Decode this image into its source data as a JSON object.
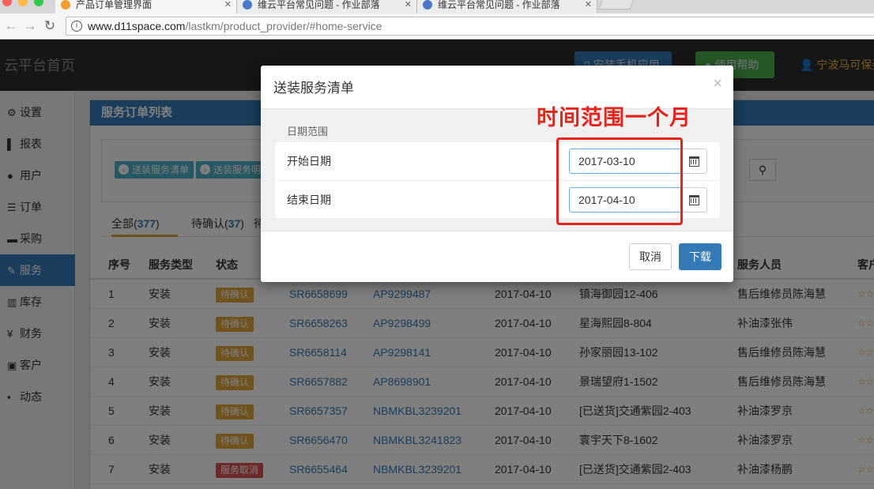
{
  "browser": {
    "tabs": [
      {
        "title": "产品订单管理界面",
        "active": true
      },
      {
        "title": "维云平台常见问题 - 作业部落",
        "active": false
      },
      {
        "title": "维云平台常见问题 - 作业部落",
        "active": false
      }
    ],
    "url_host": "www.d11space.com",
    "url_path": "/lastkm/product_provider/#home-service"
  },
  "topnav": {
    "brand": "云平台首页",
    "install_app": "安装手机应用",
    "help": "使用帮助",
    "user": "宁波马可保姿"
  },
  "sidebar": {
    "items": [
      {
        "label": "设置",
        "icon": "gear-icon"
      },
      {
        "label": "报表",
        "icon": "bar-chart-icon"
      },
      {
        "label": "用户",
        "icon": "user-icon"
      },
      {
        "label": "订单",
        "icon": "list-icon"
      },
      {
        "label": "采购",
        "icon": "cart-icon"
      },
      {
        "label": "服务",
        "icon": "wrench-icon",
        "active": true
      },
      {
        "label": "库存",
        "icon": "barcode-icon"
      },
      {
        "label": "财务",
        "icon": "yen-icon"
      },
      {
        "label": "客户",
        "icon": "briefcase-icon"
      },
      {
        "label": "动态",
        "icon": "comment-icon"
      }
    ]
  },
  "panel": {
    "title": "服务订单列表",
    "export_service_list": "送装服务清单",
    "export_service_detail": "送装服务明"
  },
  "status_tabs": [
    {
      "label": "全部(",
      "count": "377",
      "suffix": ")"
    },
    {
      "label": "待确认(",
      "count": "37",
      "suffix": ")"
    },
    {
      "label": "待",
      "count": "",
      "suffix": ""
    }
  ],
  "table": {
    "headers": [
      "序号",
      "服务类型",
      "状态",
      "服务人员",
      "客户"
    ],
    "rows": [
      {
        "no": "1",
        "type": "安装",
        "status": "待确认",
        "status_color": "orange",
        "sr": "SR6658699",
        "ap": "AP9299487",
        "date": "2017-04-10",
        "address": "镇海御园12-406",
        "staff": "售后维修员陈海慧",
        "stars": "☆☆"
      },
      {
        "no": "2",
        "type": "安装",
        "status": "待确认",
        "status_color": "orange",
        "sr": "SR6658263",
        "ap": "AP9298499",
        "date": "2017-04-10",
        "address": "星海熙园8-804",
        "staff": "补油漆张伟",
        "stars": "☆☆"
      },
      {
        "no": "3",
        "type": "安装",
        "status": "待确认",
        "status_color": "orange",
        "sr": "SR6658114",
        "ap": "AP9298141",
        "date": "2017-04-10",
        "address": "孙家丽园13-102",
        "staff": "售后维修员陈海慧",
        "stars": "☆☆"
      },
      {
        "no": "4",
        "type": "安装",
        "status": "待确认",
        "status_color": "orange",
        "sr": "SR6657882",
        "ap": "AP8698901",
        "date": "2017-04-10",
        "address": "景瑞望府1-1502",
        "staff": "售后维修员陈海慧",
        "stars": "☆☆"
      },
      {
        "no": "5",
        "type": "安装",
        "status": "待确认",
        "status_color": "orange",
        "sr": "SR6657357",
        "ap": "NBMKBL3239201",
        "date": "2017-04-10",
        "address": "[已送货]交通紫园2-403",
        "staff": "补油漆罗京",
        "stars": "☆☆"
      },
      {
        "no": "6",
        "type": "安装",
        "status": "待确认",
        "status_color": "orange",
        "sr": "SR6656470",
        "ap": "NBMKBL3241823",
        "date": "2017-04-10",
        "address": "寰宇天下8-1602",
        "staff": "补油漆罗京",
        "stars": "☆☆"
      },
      {
        "no": "7",
        "type": "安装",
        "status": "服务取消",
        "status_color": "red",
        "sr": "SR6655464",
        "ap": "NBMKBL3239201",
        "date": "2017-04-10",
        "address": "[已送货]交通紫园2-403",
        "staff": "补油漆杨鹏",
        "stars": "☆☆"
      }
    ]
  },
  "modal": {
    "title": "送装服务清单",
    "close": "×",
    "range_label": "日期范围",
    "start_label": "开始日期",
    "start_value": "2017-03-10",
    "end_label": "结束日期",
    "end_value": "2017-04-10",
    "cancel": "取消",
    "download": "下载"
  },
  "annotation": {
    "text": "时间范围一个月",
    "color": "#e8231c"
  }
}
